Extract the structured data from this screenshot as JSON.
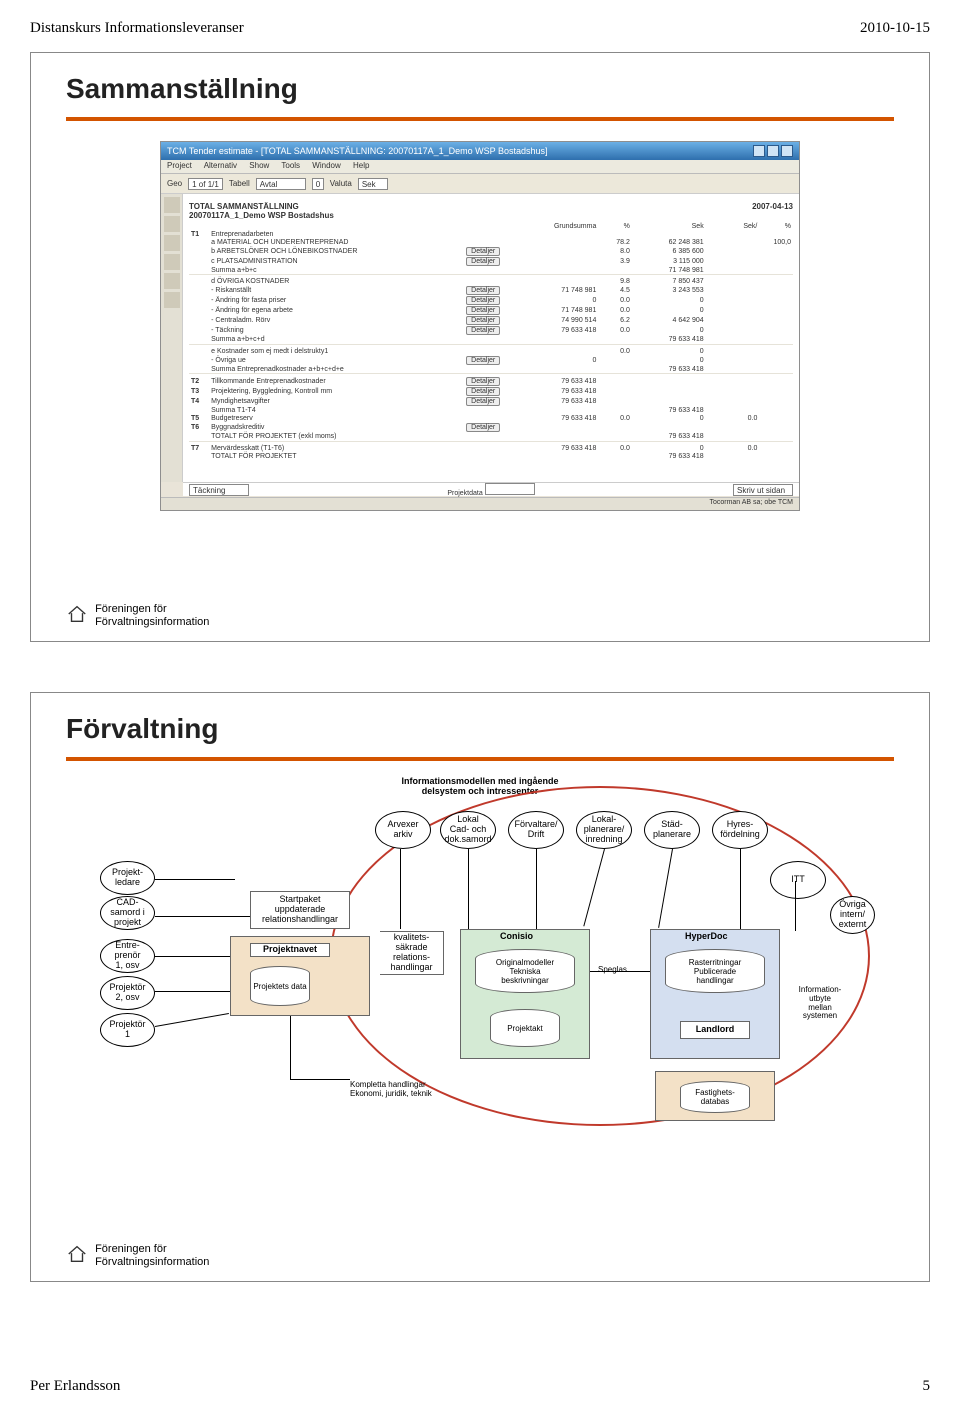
{
  "header": {
    "left": "Distanskurs Informationsleveranser",
    "right": "2010-10-15"
  },
  "footer": {
    "left": "Per  Erlandsson",
    "right": "5"
  },
  "slide1": {
    "title": "Sammanställning",
    "foot1": "Föreningen för",
    "foot2": "Förvaltningsinformation",
    "win_title": "TCM Tender estimate - [TOTAL SAMMANSTÄLLNING: 20070117A_1_Demo WSP Bostadshus]",
    "menu": {
      "project": "Project",
      "alt": "Alternativ",
      "show": "Show",
      "tools": "Tools",
      "window": "Window",
      "help": "Help"
    },
    "toolbar": {
      "geo": "Geo",
      "geo_val": "1 of 1/1",
      "tabell": "Tabell",
      "tabell_val": "Avtal",
      "valuta": "Valuta",
      "valuta_val": "Sek"
    },
    "header_title": "TOTAL SAMMANSTÄLLNING",
    "header_date": "2007-04-13",
    "sub_header": "20070117A_1_Demo WSP Bostadshus",
    "cols": {
      "grund": "Grundsumma",
      "pct": "%",
      "sek1": "Sek",
      "sekval": "Sek/",
      "pct2": "%"
    },
    "rows": [
      {
        "k": "T1",
        "t": "Entreprenadarbeten",
        "g": "",
        "p": "",
        "s": "",
        "x": "",
        "pc": ""
      },
      {
        "k": "",
        "t": "a MATERIAL OCH UNDERENTREPRENAD",
        "g": "",
        "p": "78.2",
        "s": "62 248 381",
        "x": "",
        "pc": "100,0"
      },
      {
        "k": "",
        "t": "b ARBETSLÖNER OCH LÖNEBIKOSTNADER",
        "btn": true,
        "g": "",
        "p": "8.0",
        "s": "6 385 600",
        "x": "",
        "pc": ""
      },
      {
        "k": "",
        "t": "c PLATSADMINISTRATION",
        "btn": true,
        "g": "",
        "p": "3.9",
        "s": "3 115 000",
        "x": "",
        "pc": ""
      },
      {
        "k": "",
        "t": "  Summa a+b+c",
        "g": "",
        "p": "",
        "s": "71 748 981",
        "x": "",
        "pc": ""
      },
      {
        "sep": true
      },
      {
        "k": "",
        "t": "d ÖVRIGA KOSTNADER",
        "g": "",
        "p": "9.8",
        "s": "7 850 437",
        "x": "",
        "pc": ""
      },
      {
        "k": "",
        "t": "- Riskanställt",
        "btn": true,
        "g": "71 748 981",
        "p": "4.5",
        "s": "3 243 553",
        "x": "",
        "pc": ""
      },
      {
        "k": "",
        "t": "- Ändring för fasta priser",
        "btn": true,
        "g": "0",
        "p": "0.0",
        "s": "0",
        "x": "",
        "pc": ""
      },
      {
        "k": "",
        "t": "- Ändring för egena arbete",
        "btn": true,
        "g": "71 748 981",
        "p": "0.0",
        "s": "0",
        "x": "",
        "pc": ""
      },
      {
        "k": "",
        "t": "- Centraladm. Rörv",
        "btn": true,
        "g": "74 990 514",
        "p": "6.2",
        "s": "4 642 904",
        "x": "",
        "pc": ""
      },
      {
        "k": "",
        "t": "- Täckning",
        "btn": true,
        "g": "79 633 418",
        "p": "0.0",
        "s": "0",
        "x": "",
        "pc": ""
      },
      {
        "k": "",
        "t": "  Summa a+b+c+d",
        "g": "",
        "p": "",
        "s": "79 633 418",
        "x": "",
        "pc": ""
      },
      {
        "sep": true
      },
      {
        "k": "",
        "t": "e Kostnader som ej medt i delstrukty1",
        "g": "",
        "p": "0.0",
        "s": "0",
        "x": "",
        "pc": ""
      },
      {
        "k": "",
        "t": "- Övriga ue",
        "btn": true,
        "g": "0",
        "p": "",
        "s": "0",
        "x": "",
        "pc": ""
      },
      {
        "k": "",
        "t": "Summa Entreprenadkostnader a+b+c+d+e",
        "g": "",
        "p": "",
        "s": "79 633 418",
        "x": "",
        "pc": ""
      },
      {
        "sep": true
      },
      {
        "k": "T2",
        "t": "Tillkommande Entreprenadkostnader",
        "btn": true,
        "g": "79 633 418",
        "p": "",
        "s": "",
        "x": "",
        "pc": ""
      },
      {
        "k": "T3",
        "t": "Projektering, Byggledning, Kontroll mm",
        "btn": true,
        "g": "79 633 418",
        "p": "",
        "s": "",
        "x": "",
        "pc": ""
      },
      {
        "k": "T4",
        "t": "Myndighetsavgifter",
        "btn": true,
        "g": "79 633 418",
        "p": "",
        "s": "",
        "x": "",
        "pc": ""
      },
      {
        "k": "",
        "t": "Summa T1-T4",
        "g": "",
        "p": "",
        "s": "79 633 418",
        "x": "",
        "pc": ""
      },
      {
        "k": "T5",
        "t": "Budgetreserv",
        "g": "79 633 418",
        "p": "0.0",
        "s": "0",
        "x": "0.0",
        "pc": ""
      },
      {
        "k": "T6",
        "t": "Byggnadskreditiv",
        "btn": true,
        "g": "",
        "p": "",
        "s": "",
        "x": "",
        "pc": ""
      },
      {
        "k": "",
        "t": "TOTALT FÖR PROJEKTET (exkl moms)",
        "g": "",
        "p": "",
        "s": "79 633 418",
        "x": "",
        "pc": ""
      },
      {
        "sep": true
      },
      {
        "k": "T7",
        "t": "Mervärdesskatt (T1-T6)",
        "g": "79 633 418",
        "p": "0.0",
        "s": "0",
        "x": "0.0",
        "pc": ""
      },
      {
        "k": "",
        "t": "TOTALT FÖR PROJEKTET",
        "g": "",
        "p": "",
        "s": "79 633 418",
        "x": "",
        "pc": ""
      }
    ],
    "btn_label": "Detaljer",
    "bottom": {
      "tackning": "Täckning",
      "prognos": "Projektdata"
    },
    "skriv": "Skriv ut sidan",
    "status": "Tocorman AB    sa; obe    TCM"
  },
  "slide2": {
    "title": "Förvaltning",
    "foot1": "Föreningen för",
    "foot2": "Förvaltningsinformation",
    "header_text": "Informationsmodellen med ingående\ndelsystem och intressenter",
    "ovals_top": [
      "Arvexer\narkiv",
      "Lokal\nCad- och\ndok.samord",
      "Förvaltare/\nDrift",
      "Lokal-\nplanerare/\ninredning",
      "Städ-\nplanerare",
      "Hyres-\nfördelning",
      "ITT"
    ],
    "ovals_left": [
      "Projekt-\nledare",
      "CAD-\nsamord i\nprojekt",
      "Entre-\nprenör\n1, osv",
      "Projektör\n2, osv",
      "Projektör\n1"
    ],
    "oval_right": "Övriga\nintern/\nexternt",
    "startpaket": "Startpaket\nuppdaterade\nrelationshandlingar",
    "projektnavet": "Projektnavet",
    "projektets": "Projektets\ndata",
    "kvalitets": "kvalitets-\nsäkrade\nrelations-\nhandlingar",
    "conisio": "Conisio",
    "original": "Originalmodeller\nTekniska\nbeskrivningar",
    "projektakt": "Projektakt",
    "speglas": "Speglas",
    "hyperdoc": "HyperDoc",
    "raster": "Rasterritningar\nPublicerade\nhandlingar",
    "landlord": "Landlord",
    "fastighets": "Fastighets-\ndatabas",
    "info_utbyte": "Information-\nutbyte\nmellan\nsystemen",
    "kompletta": "Kompletta handlingar\nEkonomi, juridik, teknik"
  }
}
